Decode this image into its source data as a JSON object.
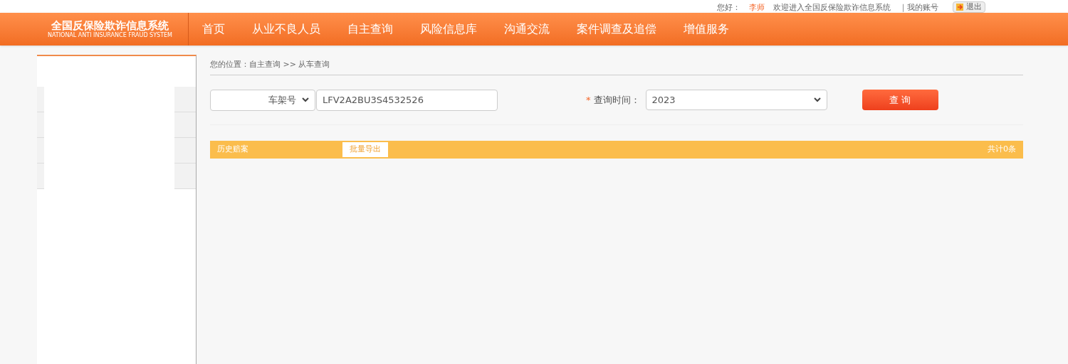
{
  "top_bar": {
    "greeting": "您好：",
    "user": "李师",
    "welcome": "欢迎进入全国反保险欺诈信息系统",
    "account_link": "｜我的账号",
    "logout": "退出"
  },
  "logo": {
    "title": "全国反保险欺诈信息系统",
    "subtitle": "NATIONAL ANTI INSURANCE FRAUD SYSTEM"
  },
  "nav": [
    {
      "label": "首页"
    },
    {
      "label": "从业不良人员"
    },
    {
      "label": "自主查询"
    },
    {
      "label": "风险信息库"
    },
    {
      "label": "沟通交流"
    },
    {
      "label": "案件调查及追偿"
    },
    {
      "label": "增值服务"
    }
  ],
  "breadcrumb": "您的位置：自主查询 >> 从车查询",
  "search": {
    "type_select": "车架号",
    "value": "LFV2A2BU3S4532526",
    "time_label": "查询时间：",
    "required_mark": "*",
    "time_select": "2023",
    "button": "查 询"
  },
  "results": {
    "title": "历史赔案",
    "export_button": "批量导出",
    "count": "共计0条"
  }
}
